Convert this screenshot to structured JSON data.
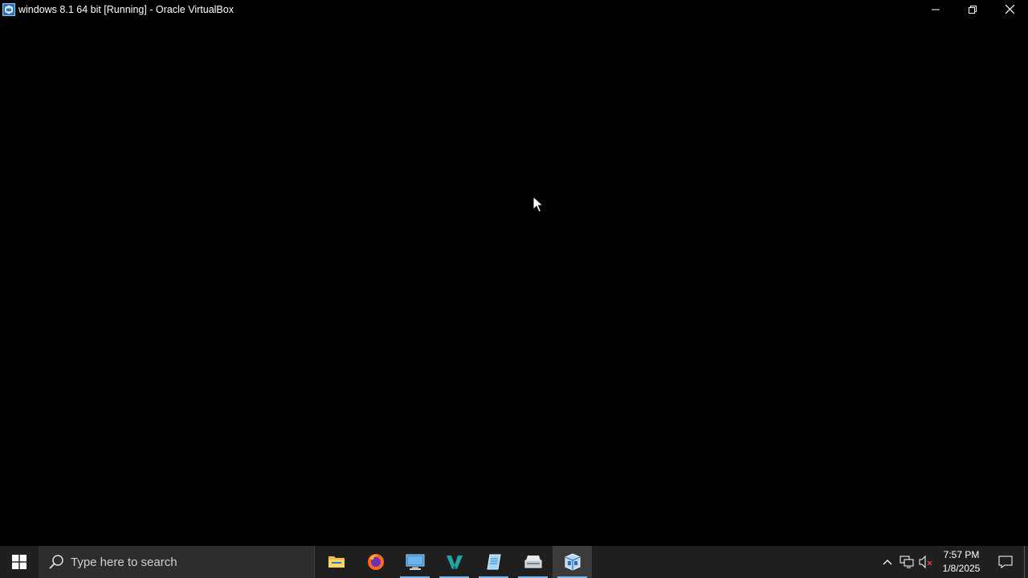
{
  "window": {
    "title": "windows 8.1 64 bit [Running] - Oracle VirtualBox",
    "icon": "virtualbox-icon",
    "controls": [
      "minimize-icon",
      "restore-icon",
      "close-icon"
    ]
  },
  "taskbar": {
    "start_icon": "windows-logo-icon",
    "search": {
      "placeholder": "Type here to search",
      "icon": "search-icon"
    },
    "pinned_apps": [
      {
        "name": "File Explorer",
        "icon": "folder-icon",
        "open": false
      },
      {
        "name": "Firefox",
        "icon": "firefox-icon",
        "open": false
      },
      {
        "name": "Remote Desktop",
        "icon": "monitor-icon",
        "open": true
      },
      {
        "name": "Visual Studio",
        "icon": "visual-studio-icon",
        "open": true
      },
      {
        "name": "Notepad",
        "icon": "notepad-icon",
        "open": true
      },
      {
        "name": "Scanner",
        "icon": "scanner-icon",
        "open": true
      },
      {
        "name": "Oracle VirtualBox",
        "icon": "virtualbox-icon",
        "open": true,
        "active": true
      }
    ],
    "tray": {
      "icons": [
        "chevron-up-icon",
        "network-icon",
        "volume-muted-icon"
      ],
      "time": "7:57 PM",
      "date": "1/8/2025",
      "notification_icon": "notification-icon"
    }
  },
  "colors": {
    "taskbar_bg": "#1f1f1f",
    "search_bg": "#2d2d2d",
    "accent_underline": "#76b9ed"
  }
}
